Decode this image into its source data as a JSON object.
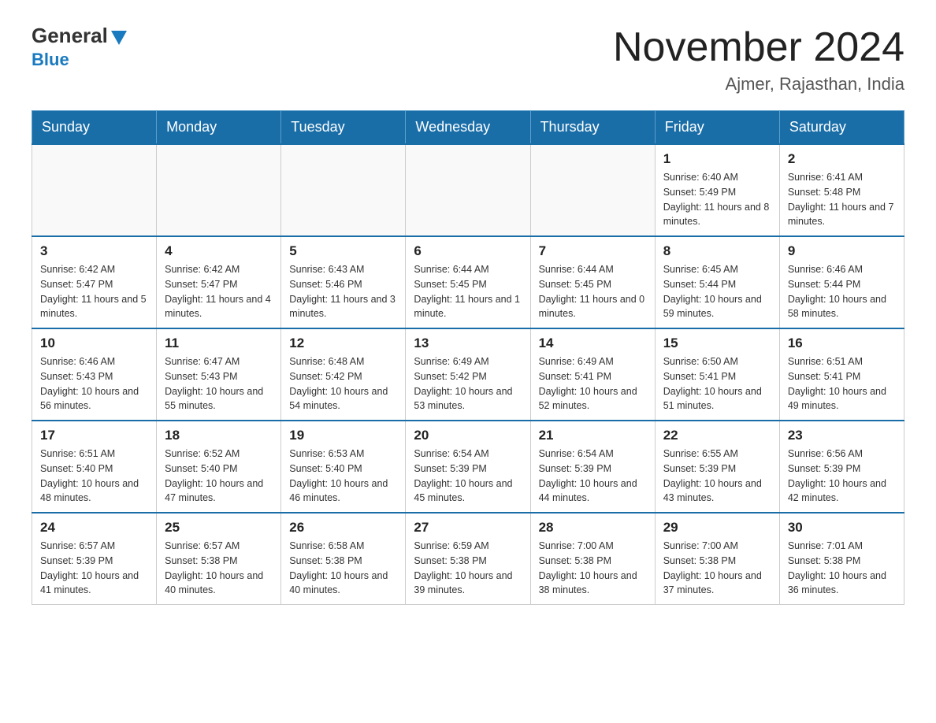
{
  "header": {
    "logo_main": "General",
    "logo_sub": "Blue",
    "month_title": "November 2024",
    "location": "Ajmer, Rajasthan, India"
  },
  "weekdays": [
    "Sunday",
    "Monday",
    "Tuesday",
    "Wednesday",
    "Thursday",
    "Friday",
    "Saturday"
  ],
  "weeks": [
    [
      {
        "day": "",
        "info": ""
      },
      {
        "day": "",
        "info": ""
      },
      {
        "day": "",
        "info": ""
      },
      {
        "day": "",
        "info": ""
      },
      {
        "day": "",
        "info": ""
      },
      {
        "day": "1",
        "info": "Sunrise: 6:40 AM\nSunset: 5:49 PM\nDaylight: 11 hours and 8 minutes."
      },
      {
        "day": "2",
        "info": "Sunrise: 6:41 AM\nSunset: 5:48 PM\nDaylight: 11 hours and 7 minutes."
      }
    ],
    [
      {
        "day": "3",
        "info": "Sunrise: 6:42 AM\nSunset: 5:47 PM\nDaylight: 11 hours and 5 minutes."
      },
      {
        "day": "4",
        "info": "Sunrise: 6:42 AM\nSunset: 5:47 PM\nDaylight: 11 hours and 4 minutes."
      },
      {
        "day": "5",
        "info": "Sunrise: 6:43 AM\nSunset: 5:46 PM\nDaylight: 11 hours and 3 minutes."
      },
      {
        "day": "6",
        "info": "Sunrise: 6:44 AM\nSunset: 5:45 PM\nDaylight: 11 hours and 1 minute."
      },
      {
        "day": "7",
        "info": "Sunrise: 6:44 AM\nSunset: 5:45 PM\nDaylight: 11 hours and 0 minutes."
      },
      {
        "day": "8",
        "info": "Sunrise: 6:45 AM\nSunset: 5:44 PM\nDaylight: 10 hours and 59 minutes."
      },
      {
        "day": "9",
        "info": "Sunrise: 6:46 AM\nSunset: 5:44 PM\nDaylight: 10 hours and 58 minutes."
      }
    ],
    [
      {
        "day": "10",
        "info": "Sunrise: 6:46 AM\nSunset: 5:43 PM\nDaylight: 10 hours and 56 minutes."
      },
      {
        "day": "11",
        "info": "Sunrise: 6:47 AM\nSunset: 5:43 PM\nDaylight: 10 hours and 55 minutes."
      },
      {
        "day": "12",
        "info": "Sunrise: 6:48 AM\nSunset: 5:42 PM\nDaylight: 10 hours and 54 minutes."
      },
      {
        "day": "13",
        "info": "Sunrise: 6:49 AM\nSunset: 5:42 PM\nDaylight: 10 hours and 53 minutes."
      },
      {
        "day": "14",
        "info": "Sunrise: 6:49 AM\nSunset: 5:41 PM\nDaylight: 10 hours and 52 minutes."
      },
      {
        "day": "15",
        "info": "Sunrise: 6:50 AM\nSunset: 5:41 PM\nDaylight: 10 hours and 51 minutes."
      },
      {
        "day": "16",
        "info": "Sunrise: 6:51 AM\nSunset: 5:41 PM\nDaylight: 10 hours and 49 minutes."
      }
    ],
    [
      {
        "day": "17",
        "info": "Sunrise: 6:51 AM\nSunset: 5:40 PM\nDaylight: 10 hours and 48 minutes."
      },
      {
        "day": "18",
        "info": "Sunrise: 6:52 AM\nSunset: 5:40 PM\nDaylight: 10 hours and 47 minutes."
      },
      {
        "day": "19",
        "info": "Sunrise: 6:53 AM\nSunset: 5:40 PM\nDaylight: 10 hours and 46 minutes."
      },
      {
        "day": "20",
        "info": "Sunrise: 6:54 AM\nSunset: 5:39 PM\nDaylight: 10 hours and 45 minutes."
      },
      {
        "day": "21",
        "info": "Sunrise: 6:54 AM\nSunset: 5:39 PM\nDaylight: 10 hours and 44 minutes."
      },
      {
        "day": "22",
        "info": "Sunrise: 6:55 AM\nSunset: 5:39 PM\nDaylight: 10 hours and 43 minutes."
      },
      {
        "day": "23",
        "info": "Sunrise: 6:56 AM\nSunset: 5:39 PM\nDaylight: 10 hours and 42 minutes."
      }
    ],
    [
      {
        "day": "24",
        "info": "Sunrise: 6:57 AM\nSunset: 5:39 PM\nDaylight: 10 hours and 41 minutes."
      },
      {
        "day": "25",
        "info": "Sunrise: 6:57 AM\nSunset: 5:38 PM\nDaylight: 10 hours and 40 minutes."
      },
      {
        "day": "26",
        "info": "Sunrise: 6:58 AM\nSunset: 5:38 PM\nDaylight: 10 hours and 40 minutes."
      },
      {
        "day": "27",
        "info": "Sunrise: 6:59 AM\nSunset: 5:38 PM\nDaylight: 10 hours and 39 minutes."
      },
      {
        "day": "28",
        "info": "Sunrise: 7:00 AM\nSunset: 5:38 PM\nDaylight: 10 hours and 38 minutes."
      },
      {
        "day": "29",
        "info": "Sunrise: 7:00 AM\nSunset: 5:38 PM\nDaylight: 10 hours and 37 minutes."
      },
      {
        "day": "30",
        "info": "Sunrise: 7:01 AM\nSunset: 5:38 PM\nDaylight: 10 hours and 36 minutes."
      }
    ]
  ]
}
